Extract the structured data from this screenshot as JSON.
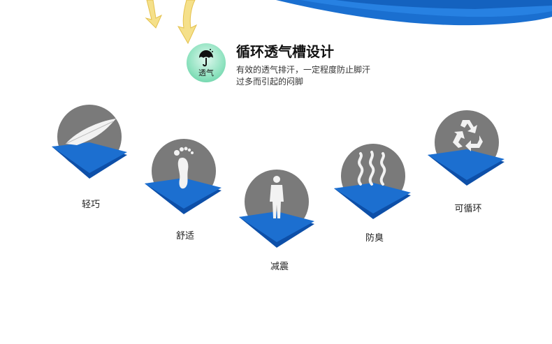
{
  "header": {
    "badge_label": "透气",
    "title": "循环透气槽设计",
    "desc_line1": "有效的透气排汗，一定程度防止脚汗",
    "desc_line2": "过多而引起的闷脚",
    "icon": "umbrella-rain-icon"
  },
  "features": [
    {
      "label": "轻巧",
      "icon": "feather-icon"
    },
    {
      "label": "舒适",
      "icon": "footprint-icon"
    },
    {
      "label": "减震",
      "icon": "human-figure-icon"
    },
    {
      "label": "防臭",
      "icon": "odor-wave-icon"
    },
    {
      "label": "可循环",
      "icon": "recycle-icon"
    }
  ],
  "colors": {
    "accent_blue": "#1667c8",
    "circle_gray": "#7a7a7a",
    "badge_green": "#8ee2bf",
    "arrow_yellow": "#f1d56a"
  }
}
